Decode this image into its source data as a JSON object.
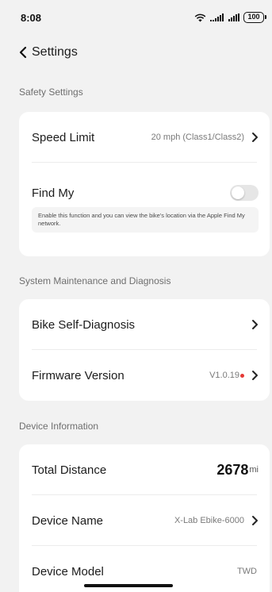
{
  "status_bar": {
    "time": "8:08",
    "battery": "100"
  },
  "nav": {
    "back_label": "Settings"
  },
  "safety": {
    "section_label": "Safety Settings",
    "speed_limit": {
      "label": "Speed Limit",
      "value": "20 mph (Class1/Class2)"
    },
    "find_my": {
      "label": "Find My",
      "enabled": false,
      "hint": "Enable this function and you can view the bike's location via the Apple Find My network."
    }
  },
  "maintenance": {
    "section_label": "System Maintenance and Diagnosis",
    "self_diagnosis": {
      "label": "Bike Self-Diagnosis"
    },
    "firmware": {
      "label": "Firmware Version",
      "value": "V1.0.19",
      "update_dot_color": "#e53935"
    }
  },
  "device": {
    "section_label": "Device Information",
    "total_distance": {
      "label": "Total Distance",
      "value": "2678",
      "unit": "mi"
    },
    "device_name": {
      "label": "Device Name",
      "value": "X-Lab Ebike-6000"
    },
    "device_model": {
      "label": "Device Model",
      "value": "TWD"
    }
  }
}
